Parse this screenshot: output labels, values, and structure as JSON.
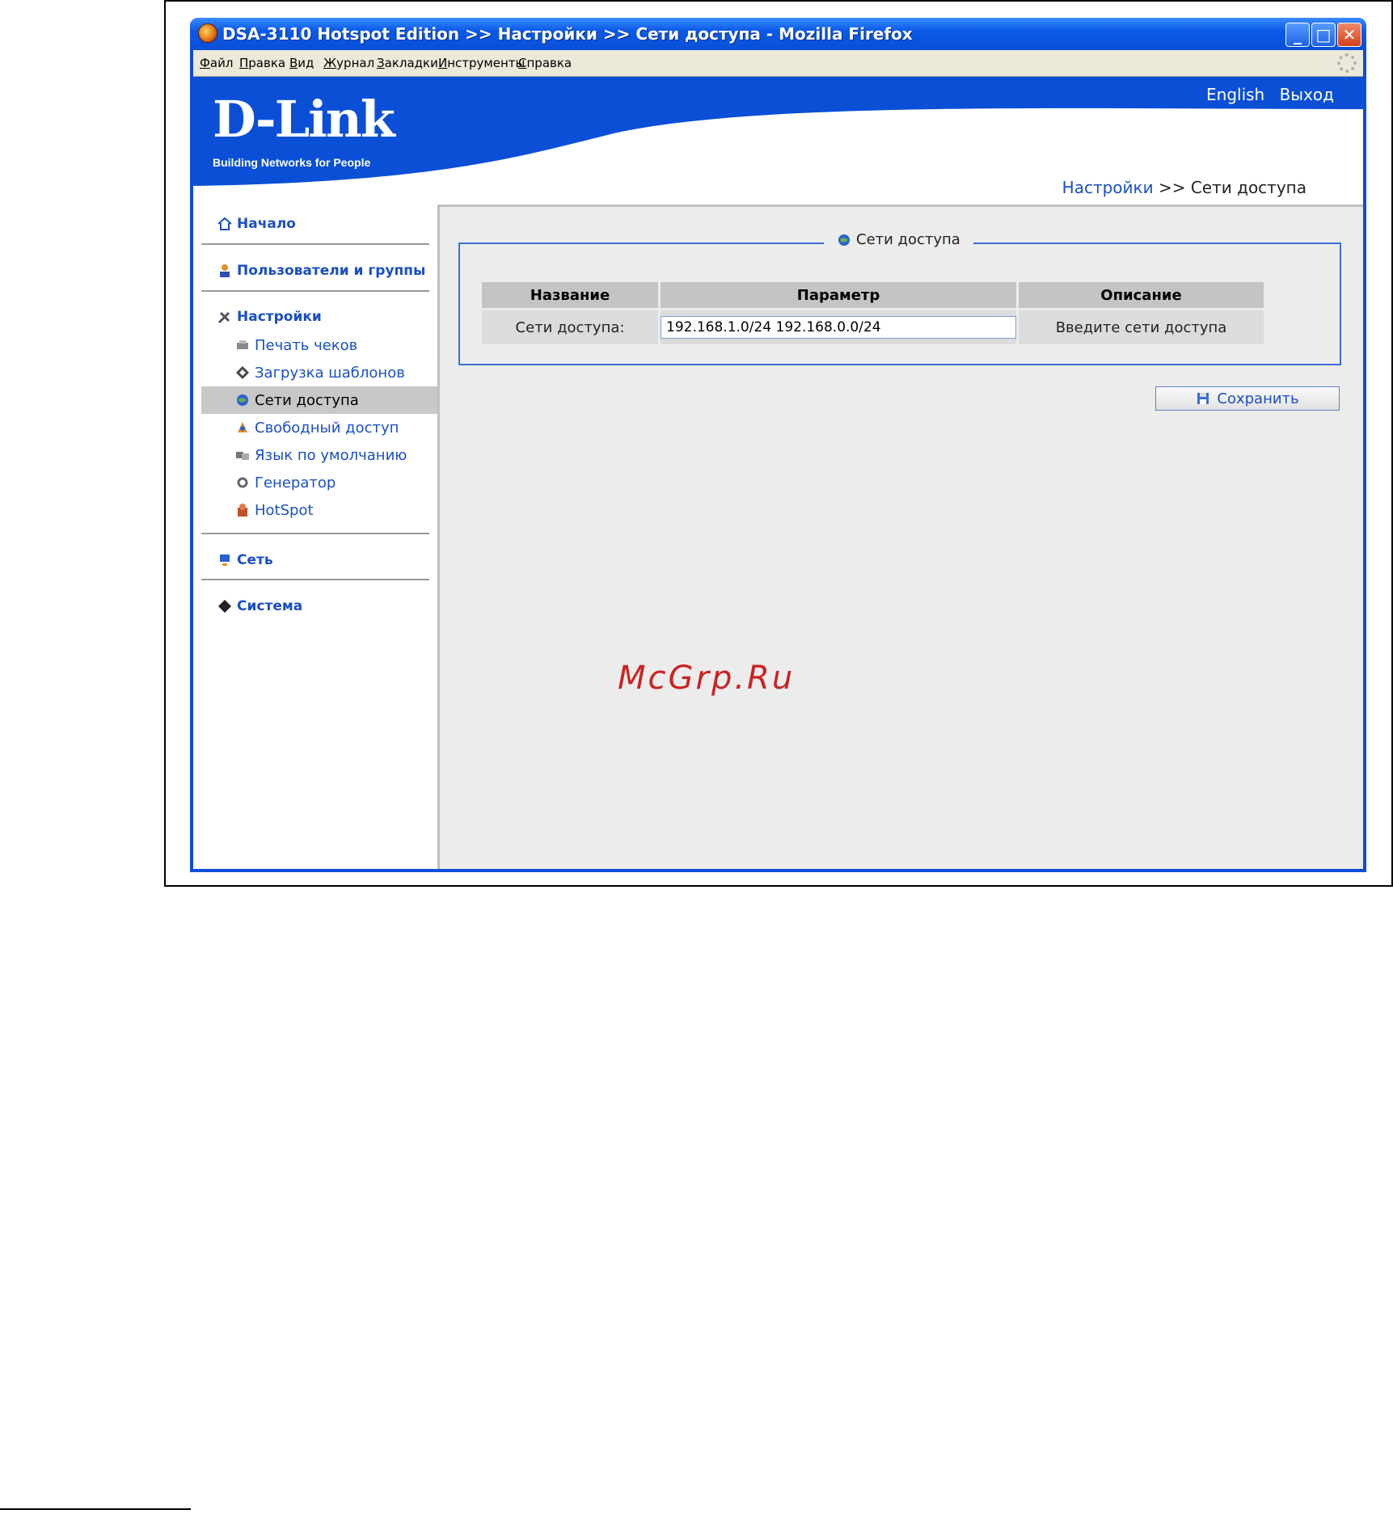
{
  "window": {
    "title": "DSA-3110 Hotspot Edition >> Настройки >> Сети доступа - Mozilla Firefox",
    "minimize": "_",
    "maximize": "□",
    "close": "✕"
  },
  "menubar": [
    "Файл",
    "Правка",
    "Вид",
    "Журнал",
    "Закладки",
    "Инструменты",
    "Справка"
  ],
  "header": {
    "logo": "D-Link",
    "tagline": "Building Networks for People",
    "links": {
      "english": "English",
      "logout": "Выход"
    },
    "breadcrumb": {
      "parent": "Настройки",
      "sep": ">>",
      "current": "Сети доступа"
    }
  },
  "sidebar": {
    "sections": {
      "home": "Начало",
      "users": "Пользователи и группы",
      "settings": "Настройки",
      "network": "Сеть",
      "system": "Система"
    },
    "settings_items": [
      {
        "label": "Печать чеков",
        "icon": "printer-icon"
      },
      {
        "label": "Загрузка шаблонов",
        "icon": "template-icon"
      },
      {
        "label": "Сети доступа",
        "icon": "network-globe-icon",
        "active": true
      },
      {
        "label": "Свободный доступ",
        "icon": "free-access-icon"
      },
      {
        "label": "Язык по умолчанию",
        "icon": "language-icon"
      },
      {
        "label": "Генератор",
        "icon": "generator-icon"
      },
      {
        "label": "HotSpot",
        "icon": "hotspot-icon"
      }
    ]
  },
  "panel": {
    "legend": "Сети доступа",
    "columns": [
      "Название",
      "Параметр",
      "Описание"
    ],
    "row": {
      "name": "Сети доступа:",
      "value": "192.168.1.0/24 192.168.0.0/24",
      "description": "Введите сети доступа"
    },
    "save_label": "Сохранить"
  },
  "watermark": "McGrp.Ru",
  "colors": {
    "brand_blue": "#0a4fd6",
    "link": "#1a4fc2",
    "panel_bg": "#ececec"
  }
}
